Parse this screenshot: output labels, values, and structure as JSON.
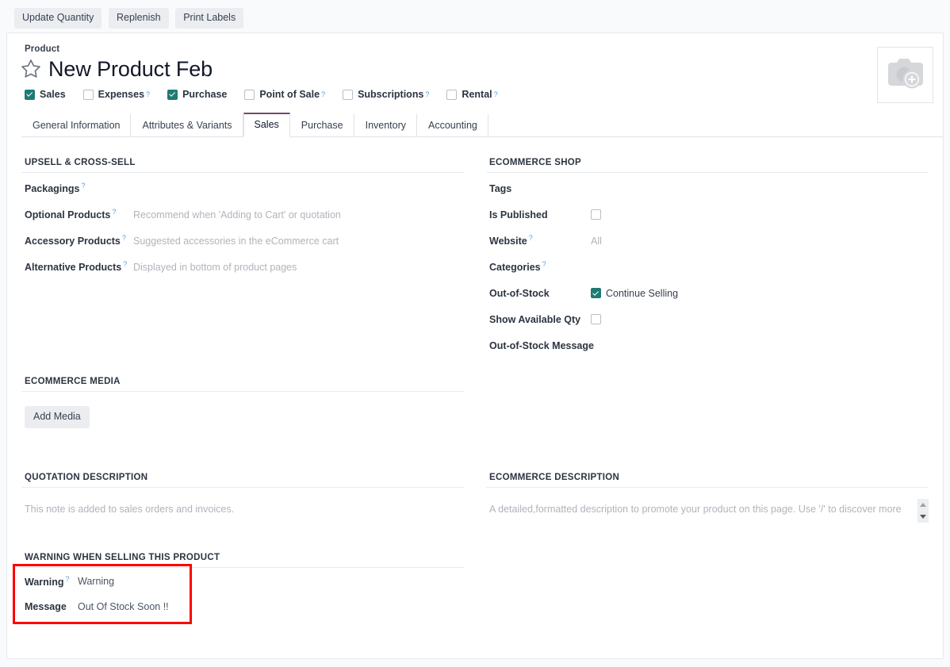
{
  "control_panel": {
    "buttons": [
      {
        "label": "Update Quantity",
        "name": "update-quantity-button"
      },
      {
        "label": "Replenish",
        "name": "replenish-button"
      },
      {
        "label": "Print Labels",
        "name": "print-labels-button"
      }
    ]
  },
  "header": {
    "record_type_label": "Product",
    "title": "New Product Feb",
    "star_icon": "star-outline-icon",
    "image_placeholder_icon": "camera-add-icon",
    "checkboxes": [
      {
        "label": "Sales",
        "checked": true,
        "help": false
      },
      {
        "label": "Expenses",
        "checked": false,
        "help": true
      },
      {
        "label": "Purchase",
        "checked": true,
        "help": false
      },
      {
        "label": "Point of Sale",
        "checked": false,
        "help": true
      },
      {
        "label": "Subscriptions",
        "checked": false,
        "help": true
      },
      {
        "label": "Rental",
        "checked": false,
        "help": true
      }
    ]
  },
  "tabs": [
    {
      "label": "General Information",
      "active": false
    },
    {
      "label": "Attributes & Variants",
      "active": false
    },
    {
      "label": "Sales",
      "active": true
    },
    {
      "label": "Purchase",
      "active": false
    },
    {
      "label": "Inventory",
      "active": false
    },
    {
      "label": "Accounting",
      "active": false
    }
  ],
  "upsell": {
    "title": "UPSELL & CROSS-SELL",
    "rows": [
      {
        "label": "Packagings",
        "help": true,
        "value": ""
      },
      {
        "label": "Optional Products",
        "help": true,
        "value": "Recommend when 'Adding to Cart' or quotation"
      },
      {
        "label": "Accessory Products",
        "help": true,
        "value": "Suggested accessories in the eCommerce cart"
      },
      {
        "label": "Alternative Products",
        "help": true,
        "value": "Displayed in bottom of product pages"
      }
    ]
  },
  "ecommerce_shop": {
    "title": "ECOMMERCE SHOP",
    "tags_label": "Tags",
    "is_published_label": "Is Published",
    "is_published_checked": false,
    "website_label": "Website",
    "website_value": "All",
    "categories_label": "Categories",
    "out_of_stock_label": "Out-of-Stock",
    "out_of_stock_checked": true,
    "out_of_stock_value": "Continue Selling",
    "show_available_qty_label": "Show Available Qty",
    "show_available_qty_checked": false,
    "out_of_stock_message_label": "Out-of-Stock Message"
  },
  "ecommerce_media": {
    "title": "ECOMMERCE MEDIA",
    "add_media_label": "Add Media"
  },
  "quotation_description": {
    "title": "QUOTATION DESCRIPTION",
    "placeholder": "This note is added to sales orders and invoices."
  },
  "ecommerce_description": {
    "title": "ECOMMERCE DESCRIPTION",
    "placeholder": "A detailed,formatted description to promote your product on this page. Use '/' to discover more"
  },
  "warning_section": {
    "title": "WARNING WHEN SELLING THIS PRODUCT",
    "warning_label": "Warning",
    "warning_value": "Warning",
    "message_label": "Message",
    "message_value": "Out Of Stock Soon !!",
    "highlight_color": "#ff0000"
  },
  "colors": {
    "accent_teal": "#1f7a73",
    "accent_purple": "#714b67",
    "page_bg": "#f9fafb",
    "muted_text": "#b0b4bb"
  }
}
